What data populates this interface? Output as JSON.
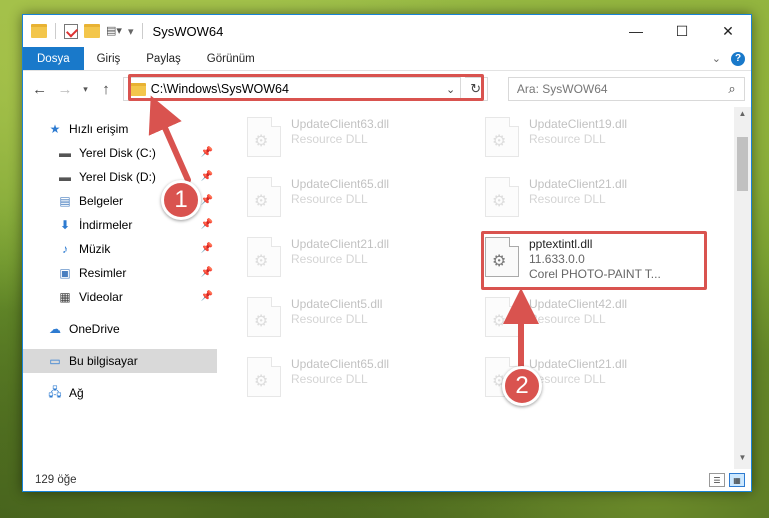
{
  "window": {
    "title": "SysWOW64",
    "controls": {
      "minimize": "—",
      "maximize": "☐",
      "close": "✕"
    }
  },
  "ribbon": {
    "tabs": [
      "Dosya",
      "Giriş",
      "Paylaş",
      "Görünüm"
    ],
    "help": "?"
  },
  "nav": {
    "address": "C:\\Windows\\SysWOW64",
    "search_placeholder": "Ara: SysWOW64"
  },
  "sidebar": {
    "quick_access": "Hızlı erişim",
    "items": [
      {
        "label": "Yerel Disk (C:)",
        "icon": "drive-icon"
      },
      {
        "label": "Yerel Disk (D:)",
        "icon": "drive-icon"
      },
      {
        "label": "Belgeler",
        "icon": "documents-icon"
      },
      {
        "label": "İndirmeler",
        "icon": "download-icon"
      },
      {
        "label": "Müzik",
        "icon": "music-icon"
      },
      {
        "label": "Resimler",
        "icon": "pictures-icon"
      },
      {
        "label": "Videolar",
        "icon": "videos-icon"
      }
    ],
    "onedrive": "OneDrive",
    "this_pc": "Bu bilgisayar",
    "network": "Ağ"
  },
  "files": {
    "left": [
      {
        "name": "UpdateClient63.dll",
        "desc": "Resource DLL"
      },
      {
        "name": "UpdateClient65.dll",
        "desc": "Resource DLL"
      },
      {
        "name": "UpdateClient21.dll",
        "desc": "Resource DLL"
      },
      {
        "name": "UpdateClient5.dll",
        "desc": "Resource DLL"
      },
      {
        "name": "UpdateClient65.dll",
        "desc": "Resource DLL"
      }
    ],
    "right": [
      {
        "name": "UpdateClient19.dll",
        "desc": "Resource DLL"
      },
      {
        "name": "UpdateClient21.dll",
        "desc": "Resource DLL"
      },
      {
        "name": "UpdateClient42.dll",
        "desc": "Resource DLL"
      },
      {
        "name": "UpdateClient21.dll",
        "desc": "Resource DLL"
      }
    ],
    "focus": {
      "name": "pptextintl.dll",
      "version": "11.633.0.0",
      "desc": "Corel PHOTO-PAINT T..."
    }
  },
  "status": {
    "count": "129 öğe"
  },
  "annotations": {
    "step1": "1",
    "step2": "2",
    "color": "#d9534f"
  }
}
